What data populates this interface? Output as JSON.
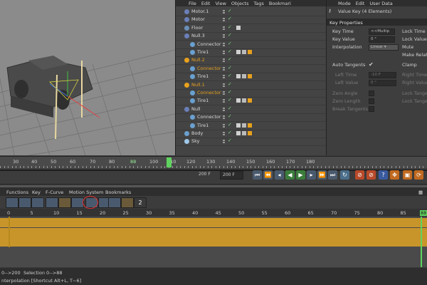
{
  "object_manager": {
    "menu": [
      "File",
      "Edit",
      "View",
      "Objects",
      "Tags",
      "Bookmari"
    ],
    "objects": [
      {
        "name": "Motor.1",
        "indent": 0,
        "orange": false
      },
      {
        "name": "Motor",
        "indent": 0,
        "orange": false
      },
      {
        "name": "Floor",
        "indent": 0,
        "orange": false
      },
      {
        "name": "Null.3",
        "indent": 0,
        "orange": false
      },
      {
        "name": "Connector",
        "indent": 1,
        "orange": false
      },
      {
        "name": "Tire1",
        "indent": 1,
        "orange": false
      },
      {
        "name": "Null.2",
        "indent": 0,
        "orange": true
      },
      {
        "name": "Connector",
        "indent": 1,
        "orange": true
      },
      {
        "name": "Tire1",
        "indent": 1,
        "orange": false
      },
      {
        "name": "Null.1",
        "indent": 0,
        "orange": true
      },
      {
        "name": "Connector",
        "indent": 1,
        "orange": true
      },
      {
        "name": "Tire1",
        "indent": 1,
        "orange": false
      },
      {
        "name": "Null",
        "indent": 0,
        "orange": false
      },
      {
        "name": "Connector",
        "indent": 1,
        "orange": false
      },
      {
        "name": "Tire1",
        "indent": 1,
        "orange": false
      },
      {
        "name": "Body",
        "indent": 0,
        "orange": false
      },
      {
        "name": "Sky",
        "indent": 0,
        "orange": false
      }
    ]
  },
  "attribute_manager": {
    "menu": [
      "Mode",
      "Edit",
      "User Data"
    ],
    "header": "Value Key (4 Elements)",
    "section": "Key Properties",
    "key_time_label": "Key Time",
    "key_time_value": "<<Multip",
    "lock_time_label": "Lock Time",
    "key_value_label": "Key Value",
    "key_value_value": "0 °",
    "lock_value_label": "Lock Value",
    "interpolation_label": "Interpolation",
    "interpolation_value": "Linear",
    "mute_label": "Mute",
    "make_relative_label": "Make Relati",
    "auto_tangents_label": "Auto Tangents",
    "auto_tangents_check": "✔",
    "clamp_label": "Clamp",
    "left_time_label": "Left Time",
    "left_time_value": "-10 F",
    "right_time_label": "Right Time",
    "left_value_label": "Left Value",
    "left_value_value": "0 °",
    "right_value_label": "Right Value",
    "zero_angle_label": "Zero Angle",
    "lock_tangent_angles_label": "Lock Tangen",
    "zero_length_label": "Zero Length",
    "lock_tangent_length_label": "Lock Tangen",
    "break_tangents_label": "Break Tangents"
  },
  "timeline_ruler": {
    "ticks": [
      "30",
      "40",
      "50",
      "60",
      "70",
      "80",
      "88",
      "100",
      "110",
      "120",
      "130",
      "140",
      "150",
      "160",
      "170",
      "180"
    ],
    "current": "88"
  },
  "transport": {
    "end_frame": "200 F",
    "frame_field": "200 F"
  },
  "timeline_editor": {
    "menu": [
      "Functions",
      "Key",
      "F-Curve",
      "Motion System",
      "Bookmarks"
    ],
    "ruler_ticks": [
      "0",
      "5",
      "10",
      "15",
      "20",
      "25",
      "30",
      "35",
      "40",
      "45",
      "50",
      "55",
      "60",
      "65",
      "70",
      "75",
      "80",
      "85",
      "88"
    ],
    "status_range": "0-->200",
    "status_selection": "Selection 0-->88",
    "status_hint": "nterpolation [Shortcut Alt+L, T~6]"
  },
  "colors": {
    "accent_green": "#5fd35f",
    "track_orange": "#c8952a",
    "selected_orange": "#e8a11d",
    "highlight_circle": "#e03030"
  }
}
